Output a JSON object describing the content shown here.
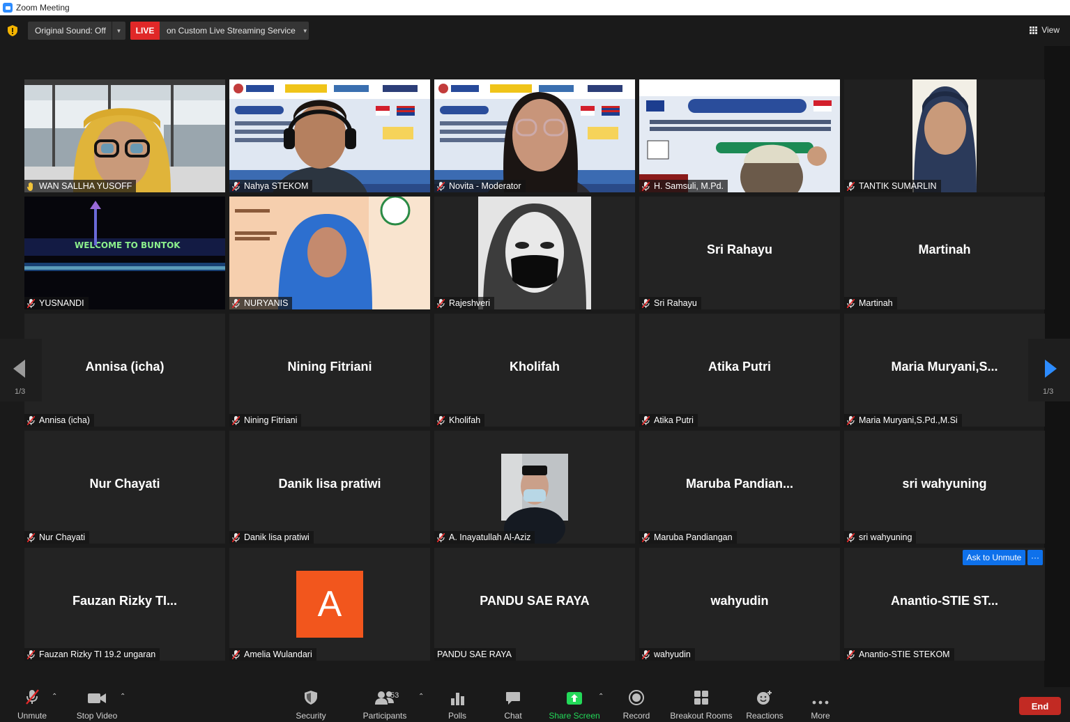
{
  "window": {
    "title": "Zoom Meeting"
  },
  "topbar": {
    "original_sound": "Original Sound: Off",
    "live_badge": "LIVE",
    "live_text": "on Custom Live Streaming Service",
    "view_label": "View"
  },
  "tiles": [
    {
      "label": "WAN SALLHA YUSOFF",
      "big": "",
      "video": "webcam-woman-hijab-city",
      "mic": "hand"
    },
    {
      "label": "Nahya STEKOM",
      "big": "",
      "video": "webcam-man-headphones-banner",
      "mic": "hand-muted"
    },
    {
      "label": "Novita - Moderator",
      "big": "",
      "video": "webcam-woman-glasses-banner",
      "mic": "hand-muted"
    },
    {
      "label": "H. Samsuli, M.Pd.",
      "big": "",
      "video": "webcam-banner-mirrored",
      "mic": "muted"
    },
    {
      "label": "TANTIK SUMARLIN",
      "big": "",
      "video": "webcam-woman-hijab-dark",
      "mic": "muted"
    },
    {
      "label": "YUSNANDI",
      "big": "",
      "video": "night-welcome-sign",
      "mic": "muted"
    },
    {
      "label": "NURYANIS",
      "big": "",
      "video": "webcam-woman-blue-hijab-peach",
      "mic": "muted"
    },
    {
      "label": "Rajeshveri",
      "big": "",
      "video": "sketch-woman-mask",
      "mic": "muted"
    },
    {
      "label": "Sri Rahayu",
      "big": "Sri Rahayu",
      "mic": "muted"
    },
    {
      "label": "Martinah",
      "big": "Martinah",
      "mic": "muted"
    },
    {
      "label": "Annisa (icha)",
      "big": "Annisa (icha)",
      "mic": "muted"
    },
    {
      "label": "Nining Fitriani",
      "big": "Nining Fitriani",
      "mic": "muted"
    },
    {
      "label": "Kholifah",
      "big": "Kholifah",
      "mic": "muted"
    },
    {
      "label": "Atika Putri",
      "big": "Atika Putri",
      "mic": "muted"
    },
    {
      "label": "Maria Muryani,S.Pd.,M.Si",
      "big": "Maria  Muryani,S...",
      "mic": "muted"
    },
    {
      "label": "Nur Chayati",
      "big": "Nur Chayati",
      "mic": "muted"
    },
    {
      "label": "Danik lisa pratiwi",
      "big": "Danik lisa pratiwi",
      "mic": "muted"
    },
    {
      "label": "A. Inayatullah Al-Aziz",
      "big": "",
      "video": "photo-man-mask",
      "mic": "muted"
    },
    {
      "label": "Maruba Pandiangan",
      "big": "Maruba  Pandian...",
      "mic": "muted"
    },
    {
      "label": "sri wahyuning",
      "big": "sri wahyuning",
      "mic": "muted"
    },
    {
      "label": "Fauzan Rizky TI 19.2 ungaran",
      "big": "Fauzan  Rizky  TI...",
      "mic": "muted"
    },
    {
      "label": "Amelia Wulandari",
      "big": "",
      "avatar": "A",
      "mic": "muted"
    },
    {
      "label": "PANDU SAE RAYA",
      "big": "PANDU SAE RAYA",
      "mic": "none"
    },
    {
      "label": "wahyudin",
      "big": "wahyudin",
      "mic": "muted"
    },
    {
      "label": "Anantio-STIE STEKOM",
      "big": "Anantio-STIE  ST...",
      "mic": "muted"
    }
  ],
  "ask_unmute": "Ask to Unmute",
  "more_dots": "···",
  "pager": {
    "left": "1/3",
    "right": "1/3"
  },
  "toolbar": {
    "unmute": "Unmute",
    "stop_video": "Stop Video",
    "security": "Security",
    "participants": "Participants",
    "participants_count": "53",
    "polls": "Polls",
    "chat": "Chat",
    "share_screen": "Share Screen",
    "record": "Record",
    "breakout": "Breakout Rooms",
    "reactions": "Reactions",
    "more": "More",
    "end": "End"
  },
  "colors": {
    "accent": "#2d8cff",
    "live": "#e02828",
    "end": "#c22a23",
    "share": "#23d959",
    "active_speaker": "#d7e84c",
    "avatar": "#f2561d"
  }
}
